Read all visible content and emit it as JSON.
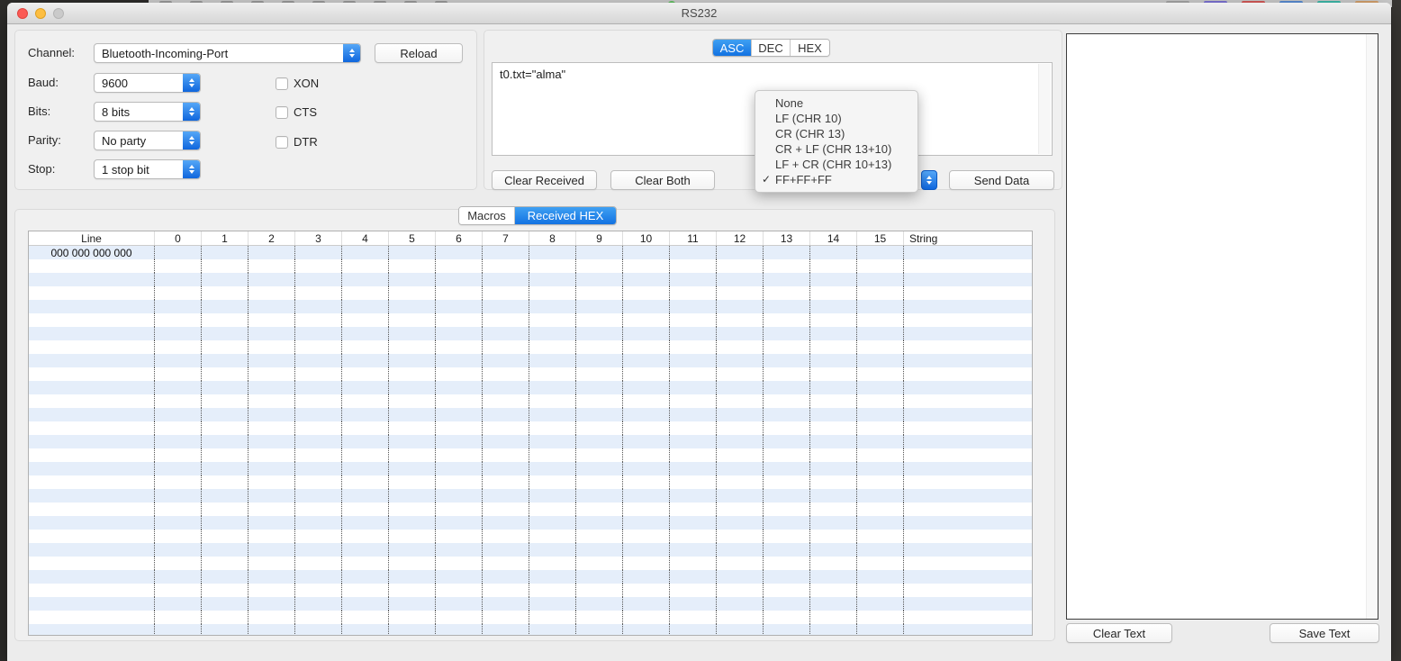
{
  "window": {
    "title": "RS232",
    "traffic_lights": {
      "close": "#fb5a55",
      "minimize": "#fdbe41",
      "zoom": "#cacaca"
    }
  },
  "backdrop": {
    "extension_icon_colors": [
      "#a9a9a9",
      "#7e74d8",
      "#d95b59",
      "#5b8fd8",
      "#3fbdae",
      "#d8a36e",
      "#8d8d8d"
    ],
    "toolbar_icon_color": "#9d9d9d",
    "green_dot_color": "#65c466"
  },
  "accent_color": "#1f8ceb",
  "connection": {
    "channel_label": "Channel:",
    "channel_value": "Bluetooth-Incoming-Port",
    "reload_label": "Reload",
    "baud_label": "Baud:",
    "baud_value": "9600",
    "bits_label": "Bits:",
    "bits_value": "8 bits",
    "parity_label": "Parity:",
    "parity_value": "No party",
    "stop_label": "Stop:",
    "stop_value": "1 stop bit",
    "flags": [
      {
        "label": "XON",
        "checked": false
      },
      {
        "label": "CTS",
        "checked": false
      },
      {
        "label": "DTR",
        "checked": false
      }
    ]
  },
  "send_panel": {
    "format_tabs": [
      "ASC",
      "DEC",
      "HEX"
    ],
    "active_format_tab": "ASC",
    "send_text": "t0.txt=\"alma\"",
    "clear_received_label": "Clear Received",
    "clear_both_label": "Clear Both",
    "send_data_label": "Send Data"
  },
  "line_ending_menu": {
    "items": [
      "None",
      "LF (CHR 10)",
      "CR (CHR 13)",
      "CR + LF (CHR 13+10)",
      "LF + CR (CHR 10+13)",
      "FF+FF+FF"
    ],
    "selected": "FF+FF+FF",
    "checkmark": "✓"
  },
  "data_panel": {
    "tabs": [
      "Macros",
      "Received HEX"
    ],
    "active_tab": "Received HEX",
    "table": {
      "columns": [
        "Line",
        "0",
        "1",
        "2",
        "3",
        "4",
        "5",
        "6",
        "7",
        "8",
        "9",
        "10",
        "11",
        "12",
        "13",
        "14",
        "15",
        "String"
      ],
      "rows": [
        {
          "line": "000 000 000 000",
          "cells": [
            "",
            "",
            "",
            "",
            "",
            "",
            "",
            "",
            "",
            "",
            "",
            "",
            "",
            "",
            "",
            ""
          ],
          "string": ""
        }
      ],
      "visible_row_count": 29
    }
  },
  "received_text_panel": {
    "content": "",
    "clear_text_label": "Clear Text",
    "save_text_label": "Save Text"
  }
}
